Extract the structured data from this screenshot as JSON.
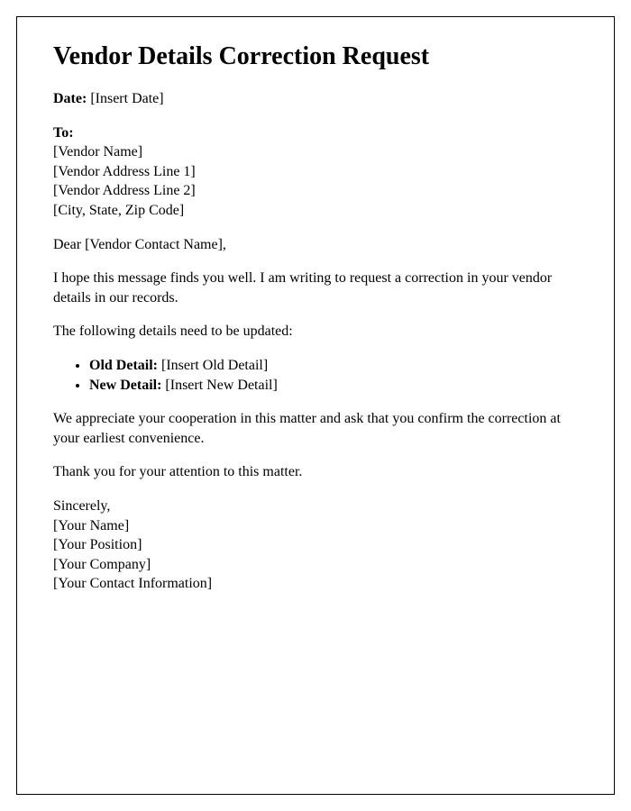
{
  "title": "Vendor Details Correction Request",
  "date": {
    "label": "Date:",
    "value": " [Insert Date]"
  },
  "to": {
    "label": "To:",
    "lines": [
      "[Vendor Name]",
      "[Vendor Address Line 1]",
      "[Vendor Address Line 2]",
      "[City, State, Zip Code]"
    ]
  },
  "salutation": "Dear [Vendor Contact Name],",
  "intro": "I hope this message finds you well. I am writing to request a correction in your vendor details in our records.",
  "details_lead": "The following details need to be updated:",
  "details": {
    "old_label": "Old Detail:",
    "old_value": " [Insert Old Detail]",
    "new_label": "New Detail:",
    "new_value": " [Insert New Detail]"
  },
  "cooperation": "We appreciate your cooperation in this matter and ask that you confirm the correction at your earliest convenience.",
  "thanks": "Thank you for your attention to this matter.",
  "closing": {
    "signoff": "Sincerely,",
    "lines": [
      "[Your Name]",
      "[Your Position]",
      "[Your Company]",
      "[Your Contact Information]"
    ]
  }
}
